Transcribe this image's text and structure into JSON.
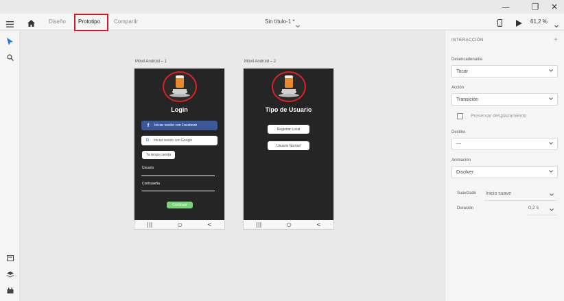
{
  "window": {
    "minimize_glyph": "—",
    "restore_glyph": "❐",
    "close_glyph": "✕"
  },
  "toolbar": {
    "tabs": [
      {
        "label": "Diseño"
      },
      {
        "label": "Prototipo"
      },
      {
        "label": "Compartir"
      }
    ],
    "doc_title": "Sin título-1 *",
    "zoom": "61,2 %"
  },
  "artboards": [
    {
      "label": "Móvil Android – 1",
      "title": "Login",
      "facebook_button": "Iniciar sesión con Facebook",
      "google_button": "Iniciar sesión con Google",
      "account_button": "Ya tengo cuenta",
      "user_label": "Usuario",
      "password_label": "Contraseña",
      "continue_button": "Continuar",
      "nav": [
        "|||",
        "○",
        "<"
      ]
    },
    {
      "label": "Móvil Android – 2",
      "title": "Tipo de Usuario",
      "register_button": "Registrar Local",
      "normal_button": "Usuario Normal",
      "nav": [
        "|||",
        "○",
        "<"
      ]
    }
  ],
  "panel": {
    "heading": "INTERACCIÓN",
    "add": "+",
    "trigger_label": "Desencadenante",
    "trigger_value": "Tocar",
    "action_label": "Acción",
    "action_value": "Transición",
    "preserve_label": "Preservar desplazamiento",
    "destination_label": "Destino",
    "destination_value": "---",
    "animation_label": "Animación",
    "animation_value": "Disolver",
    "easing_label": "Suavizado",
    "easing_value": "Inicio suave",
    "duration_label": "Duración",
    "duration_value": "0,2 s"
  },
  "colors": {
    "highlight": "#d81b22",
    "facebook": "#3b5998",
    "continue": "#7bd27b",
    "artboard_bg": "#252525",
    "select_arrow": "#1473e6"
  }
}
